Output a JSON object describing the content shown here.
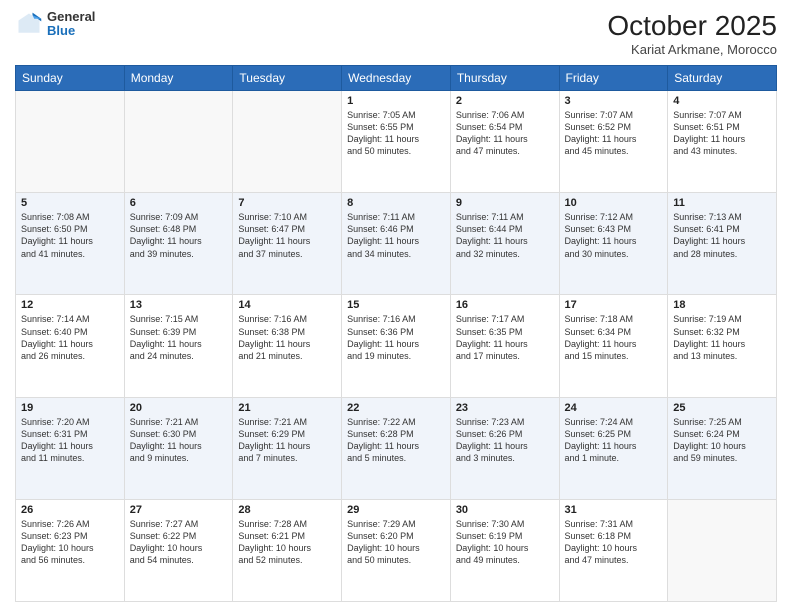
{
  "header": {
    "logo_general": "General",
    "logo_blue": "Blue",
    "month_title": "October 2025",
    "location": "Kariat Arkmane, Morocco"
  },
  "days_of_week": [
    "Sunday",
    "Monday",
    "Tuesday",
    "Wednesday",
    "Thursday",
    "Friday",
    "Saturday"
  ],
  "weeks": [
    {
      "alt": false,
      "days": [
        {
          "num": "",
          "info": ""
        },
        {
          "num": "",
          "info": ""
        },
        {
          "num": "",
          "info": ""
        },
        {
          "num": "1",
          "info": "Sunrise: 7:05 AM\nSunset: 6:55 PM\nDaylight: 11 hours\nand 50 minutes."
        },
        {
          "num": "2",
          "info": "Sunrise: 7:06 AM\nSunset: 6:54 PM\nDaylight: 11 hours\nand 47 minutes."
        },
        {
          "num": "3",
          "info": "Sunrise: 7:07 AM\nSunset: 6:52 PM\nDaylight: 11 hours\nand 45 minutes."
        },
        {
          "num": "4",
          "info": "Sunrise: 7:07 AM\nSunset: 6:51 PM\nDaylight: 11 hours\nand 43 minutes."
        }
      ]
    },
    {
      "alt": true,
      "days": [
        {
          "num": "5",
          "info": "Sunrise: 7:08 AM\nSunset: 6:50 PM\nDaylight: 11 hours\nand 41 minutes."
        },
        {
          "num": "6",
          "info": "Sunrise: 7:09 AM\nSunset: 6:48 PM\nDaylight: 11 hours\nand 39 minutes."
        },
        {
          "num": "7",
          "info": "Sunrise: 7:10 AM\nSunset: 6:47 PM\nDaylight: 11 hours\nand 37 minutes."
        },
        {
          "num": "8",
          "info": "Sunrise: 7:11 AM\nSunset: 6:46 PM\nDaylight: 11 hours\nand 34 minutes."
        },
        {
          "num": "9",
          "info": "Sunrise: 7:11 AM\nSunset: 6:44 PM\nDaylight: 11 hours\nand 32 minutes."
        },
        {
          "num": "10",
          "info": "Sunrise: 7:12 AM\nSunset: 6:43 PM\nDaylight: 11 hours\nand 30 minutes."
        },
        {
          "num": "11",
          "info": "Sunrise: 7:13 AM\nSunset: 6:41 PM\nDaylight: 11 hours\nand 28 minutes."
        }
      ]
    },
    {
      "alt": false,
      "days": [
        {
          "num": "12",
          "info": "Sunrise: 7:14 AM\nSunset: 6:40 PM\nDaylight: 11 hours\nand 26 minutes."
        },
        {
          "num": "13",
          "info": "Sunrise: 7:15 AM\nSunset: 6:39 PM\nDaylight: 11 hours\nand 24 minutes."
        },
        {
          "num": "14",
          "info": "Sunrise: 7:16 AM\nSunset: 6:38 PM\nDaylight: 11 hours\nand 21 minutes."
        },
        {
          "num": "15",
          "info": "Sunrise: 7:16 AM\nSunset: 6:36 PM\nDaylight: 11 hours\nand 19 minutes."
        },
        {
          "num": "16",
          "info": "Sunrise: 7:17 AM\nSunset: 6:35 PM\nDaylight: 11 hours\nand 17 minutes."
        },
        {
          "num": "17",
          "info": "Sunrise: 7:18 AM\nSunset: 6:34 PM\nDaylight: 11 hours\nand 15 minutes."
        },
        {
          "num": "18",
          "info": "Sunrise: 7:19 AM\nSunset: 6:32 PM\nDaylight: 11 hours\nand 13 minutes."
        }
      ]
    },
    {
      "alt": true,
      "days": [
        {
          "num": "19",
          "info": "Sunrise: 7:20 AM\nSunset: 6:31 PM\nDaylight: 11 hours\nand 11 minutes."
        },
        {
          "num": "20",
          "info": "Sunrise: 7:21 AM\nSunset: 6:30 PM\nDaylight: 11 hours\nand 9 minutes."
        },
        {
          "num": "21",
          "info": "Sunrise: 7:21 AM\nSunset: 6:29 PM\nDaylight: 11 hours\nand 7 minutes."
        },
        {
          "num": "22",
          "info": "Sunrise: 7:22 AM\nSunset: 6:28 PM\nDaylight: 11 hours\nand 5 minutes."
        },
        {
          "num": "23",
          "info": "Sunrise: 7:23 AM\nSunset: 6:26 PM\nDaylight: 11 hours\nand 3 minutes."
        },
        {
          "num": "24",
          "info": "Sunrise: 7:24 AM\nSunset: 6:25 PM\nDaylight: 11 hours\nand 1 minute."
        },
        {
          "num": "25",
          "info": "Sunrise: 7:25 AM\nSunset: 6:24 PM\nDaylight: 10 hours\nand 59 minutes."
        }
      ]
    },
    {
      "alt": false,
      "days": [
        {
          "num": "26",
          "info": "Sunrise: 7:26 AM\nSunset: 6:23 PM\nDaylight: 10 hours\nand 56 minutes."
        },
        {
          "num": "27",
          "info": "Sunrise: 7:27 AM\nSunset: 6:22 PM\nDaylight: 10 hours\nand 54 minutes."
        },
        {
          "num": "28",
          "info": "Sunrise: 7:28 AM\nSunset: 6:21 PM\nDaylight: 10 hours\nand 52 minutes."
        },
        {
          "num": "29",
          "info": "Sunrise: 7:29 AM\nSunset: 6:20 PM\nDaylight: 10 hours\nand 50 minutes."
        },
        {
          "num": "30",
          "info": "Sunrise: 7:30 AM\nSunset: 6:19 PM\nDaylight: 10 hours\nand 49 minutes."
        },
        {
          "num": "31",
          "info": "Sunrise: 7:31 AM\nSunset: 6:18 PM\nDaylight: 10 hours\nand 47 minutes."
        },
        {
          "num": "",
          "info": ""
        }
      ]
    }
  ]
}
